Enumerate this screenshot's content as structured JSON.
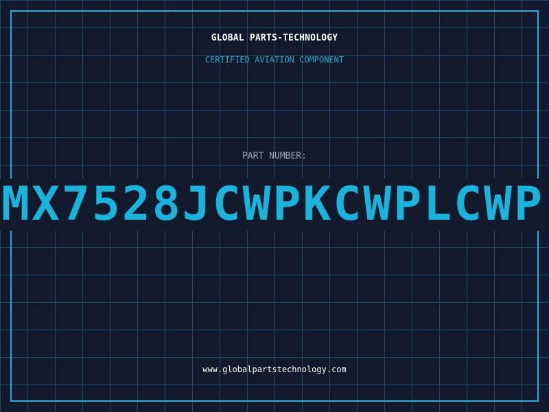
{
  "header": {
    "company": "GLOBAL PARTS-TECHNOLOGY",
    "tagline": "CERTIFIED AVIATION COMPONENT"
  },
  "part": {
    "label": "PART NUMBER:",
    "number": "MX7528JCWPKCWPLCWP"
  },
  "footer": {
    "website": "www.globalpartstechnology.com"
  },
  "colors": {
    "background": "#111a2d",
    "grid": "#1e4a63",
    "accent": "#1ab3dc",
    "label": "#9aa6b6",
    "text": "#ffffff"
  }
}
